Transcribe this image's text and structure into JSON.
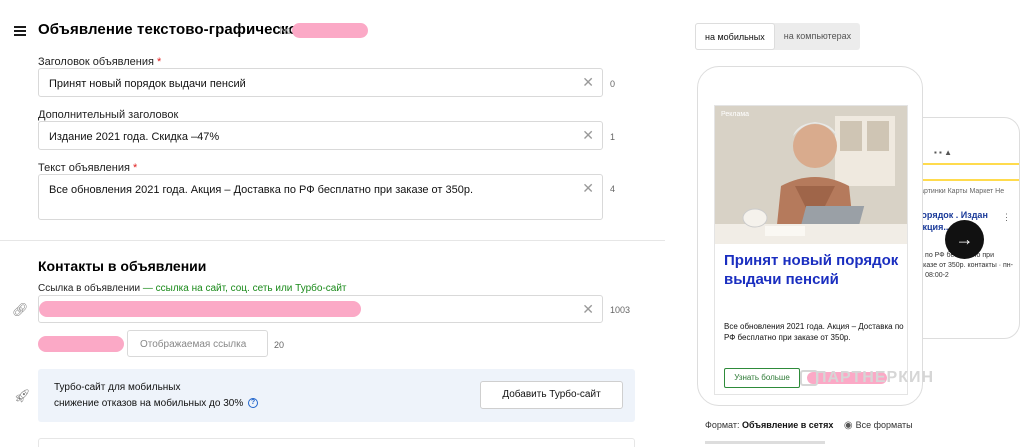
{
  "header": {
    "title": "Объявление текстово-графическое",
    "number_prefix": "№"
  },
  "fields": {
    "headline": {
      "label": "Заголовок объявления",
      "required_mark": "*",
      "value": "Принят новый порядок выдачи пенсий",
      "counter": "0"
    },
    "subheadline": {
      "label": "Дополнительный заголовок",
      "value": "Издание 2021 года. Скидка –47%",
      "counter": "1"
    },
    "body": {
      "label": "Текст объявления",
      "required_mark": "*",
      "value": "Все обновления 2021 года. Акция – Доставка по РФ бесплатно при заказе от 350р.",
      "counter": "4"
    }
  },
  "contacts": {
    "title": "Контакты в объявлении",
    "link_label": "Ссылка в объявлении",
    "link_hint": " — ссылка на сайт, соц. сеть или Турбо-сайт",
    "link_counter": "1003",
    "display_link_placeholder": "Отображаемая ссылка",
    "display_link_counter": "20"
  },
  "turbo": {
    "title": "Турбо-сайт для мобильных",
    "subtitle": "снижение отказов на мобильных до 30%",
    "help_icon": "?",
    "button": "Добавить Турбо-сайт"
  },
  "preview": {
    "tabs": [
      {
        "label": "на мобильных",
        "active": true
      },
      {
        "label": "на компьютерах",
        "active": false
      }
    ],
    "ad": {
      "badge": "Реклама",
      "headline": "Принят новый порядок выдачи пенсий",
      "text": "Все обновления 2021 года. Акция – Доставка по РФ бесплатно при заказе от 350р.",
      "button": "Узнать больше"
    },
    "second_phone": {
      "tabs": "Картинки  Карты  Маркет  Не",
      "title": "порядок . Издан Акция...",
      "lines": "ка по РФ бесплатно при заказе от 350р. контакты · пн-вс 08:00-2"
    },
    "next_icon": "→",
    "watermark": "ПАРТНЕРКИН",
    "format_label": "Формат: ",
    "format_value": "Объявление в сетях",
    "all_formats": "Все форматы"
  },
  "colors": {
    "headline_blue": "#1a2ec0",
    "hint_green": "#1a8a1a",
    "required_red": "#e02020",
    "turbo_bg": "#eef3fa",
    "redaction_pink": "#fba9c6"
  }
}
